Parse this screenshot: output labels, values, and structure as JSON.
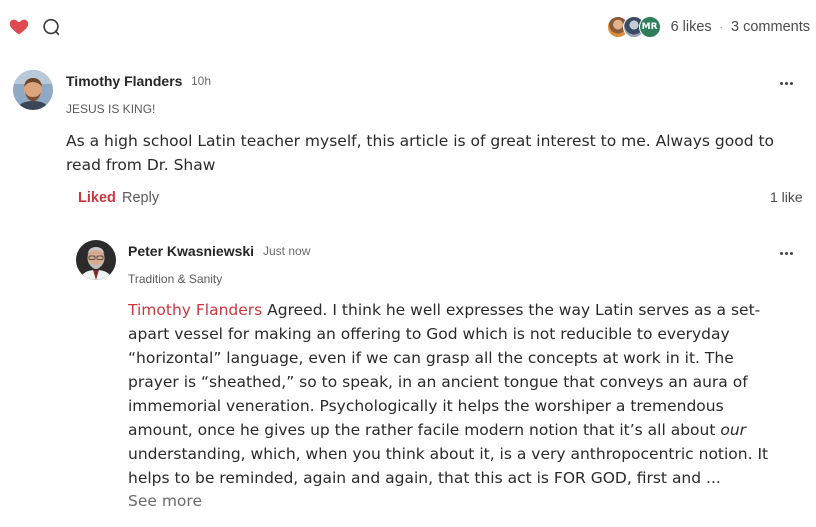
{
  "toolbar": {
    "likes_label": "6 likes",
    "comments_label": "3 comments",
    "separator": "·",
    "liker_initials": "MR",
    "heart_color": "#e0484f"
  },
  "comments": [
    {
      "author": "Timothy Flanders",
      "time": "10h",
      "tagline": "JESUS IS KING!",
      "body_lines": [
        "As a high school Latin teacher myself, this article is of great interest to me. Always good to",
        "read from Dr. Shaw"
      ],
      "liked_label": "Liked",
      "reply_label": "Reply",
      "like_count": "1 like"
    }
  ],
  "reply": {
    "author": "Peter Kwasniewski",
    "time": "Just now",
    "tagline": "Tradition & Sanity",
    "mention": "Timothy Flanders",
    "line1_rest": " Agreed. I think he well expresses the way Latin serves as a set-",
    "lines": [
      "apart vessel for making an offering to God which is not reducible to everyday",
      "“horizontal” language, even if we can grasp all the concepts at work in it. The",
      "prayer is “sheathed,” so to speak, in an ancient tongue that conveys an aura of",
      "immemorial veneration. Psychologically it helps the worshiper a tremendous"
    ],
    "line6_before": "amount, once he gives up the rather facile modern notion that it’s all about ",
    "line6_italic": "our",
    "lines_after": [
      "understanding, which, when you think about it, is a very anthropocentric notion. It",
      "helps to be reminded, again and again, that this act is FOR GOD, first and ..."
    ],
    "see_more_label": "See more"
  }
}
